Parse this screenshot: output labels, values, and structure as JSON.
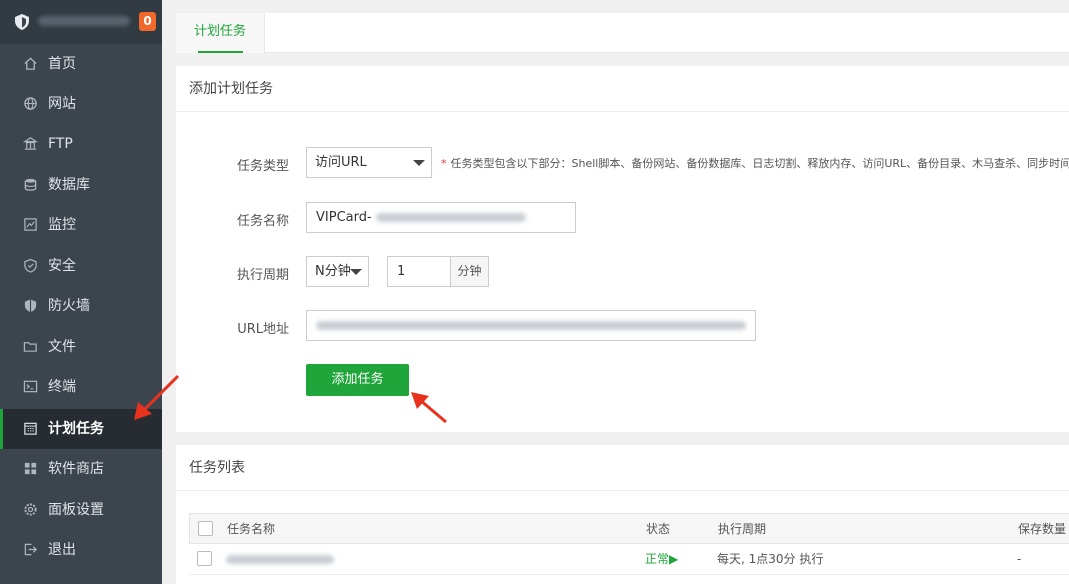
{
  "sidebar": {
    "badge": "0",
    "items": [
      {
        "label": "首页",
        "icon": "home-icon"
      },
      {
        "label": "网站",
        "icon": "globe-icon"
      },
      {
        "label": "FTP",
        "icon": "ftp-icon"
      },
      {
        "label": "数据库",
        "icon": "database-icon"
      },
      {
        "label": "监控",
        "icon": "monitor-icon"
      },
      {
        "label": "安全",
        "icon": "shield-icon"
      },
      {
        "label": "防火墙",
        "icon": "firewall-icon"
      },
      {
        "label": "文件",
        "icon": "folder-icon"
      },
      {
        "label": "终端",
        "icon": "terminal-icon"
      },
      {
        "label": "计划任务",
        "icon": "calendar-icon",
        "active": true
      },
      {
        "label": "软件商店",
        "icon": "apps-icon"
      },
      {
        "label": "面板设置",
        "icon": "gear-icon"
      },
      {
        "label": "退出",
        "icon": "logout-icon"
      }
    ]
  },
  "tabs": [
    {
      "label": "计划任务",
      "active": true
    }
  ],
  "add_task": {
    "title": "添加计划任务",
    "task_type": {
      "label": "任务类型",
      "value": "访问URL",
      "hint": "任务类型包含以下部分：Shell脚本、备份网站、备份数据库、日志切割、释放内存、访问URL、备份目录、木马查杀、同步时间"
    },
    "task_name": {
      "label": "任务名称",
      "value": "VIPCard-"
    },
    "period": {
      "label": "执行周期",
      "unit_select": "N分钟",
      "value": "1",
      "unit": "分钟"
    },
    "url": {
      "label": "URL地址"
    },
    "submit_label": "添加任务"
  },
  "task_list": {
    "title": "任务列表",
    "columns": [
      "任务名称",
      "状态",
      "执行周期",
      "保存数量"
    ],
    "rows": [
      {
        "status": "正常▶",
        "period": "每天, 1点30分 执行",
        "keep": "-"
      }
    ]
  },
  "colors": {
    "accent": "#20a53a",
    "sidebar_bg": "#3c444d",
    "badge": "#f0692a",
    "annotation_arrow": "#e8321e"
  }
}
